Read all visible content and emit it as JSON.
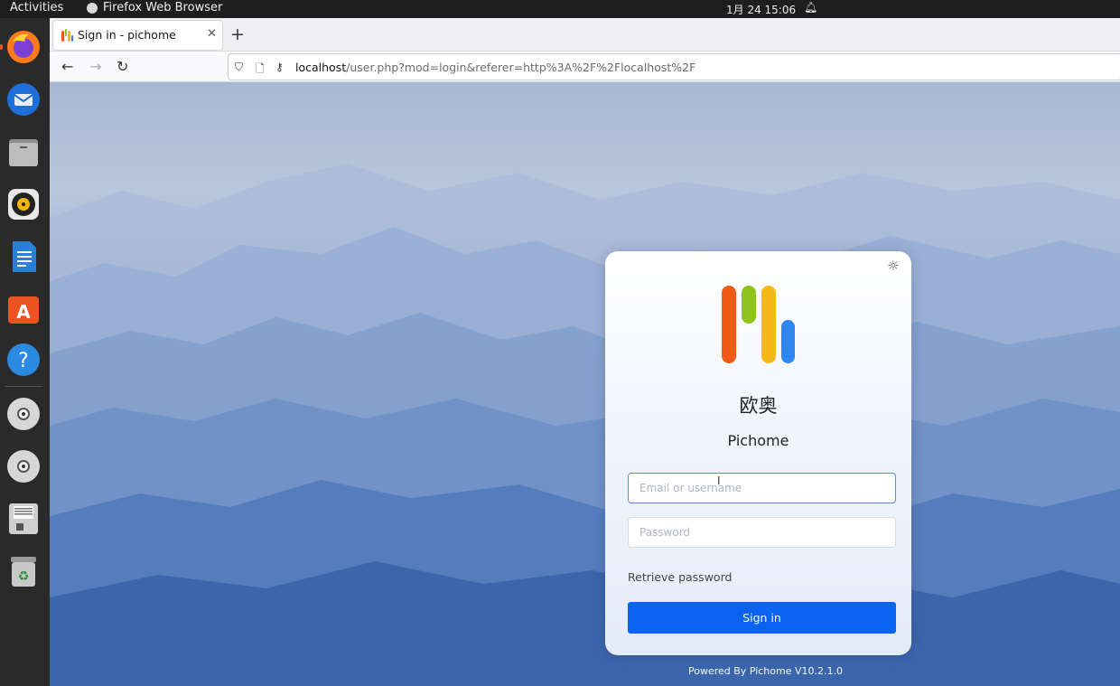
{
  "topbar": {
    "activities": "Activities",
    "app_name": "Firefox Web Browser",
    "clock": "1月 24  15:06"
  },
  "dock": {
    "items": [
      "firefox-icon",
      "thunderbird-icon",
      "files-icon",
      "rhythmbox-icon",
      "writer-icon",
      "app-center-icon",
      "help-icon",
      "disc-icon",
      "disc-icon",
      "floppy-icon",
      "trash-icon"
    ]
  },
  "browser": {
    "tab_title": "Sign in - pichome",
    "url_host": "localhost",
    "url_path": "/user.php?mod=login&referer=http%3A%2F%2Flocalhost%2F"
  },
  "login": {
    "brand_cn": "欧奥",
    "brand_en": "Pichome",
    "username_placeholder": "Email or username",
    "password_placeholder": "Password",
    "forgot_label": "Retrieve password",
    "signin_label": "Sign in",
    "powered": "Powered By Pichome V10.2.1.0"
  },
  "colors": {
    "accent": "#0a64f0",
    "logo": [
      "#f05a14",
      "#8dc21f",
      "#f5b81b",
      "#2f86f0"
    ]
  }
}
